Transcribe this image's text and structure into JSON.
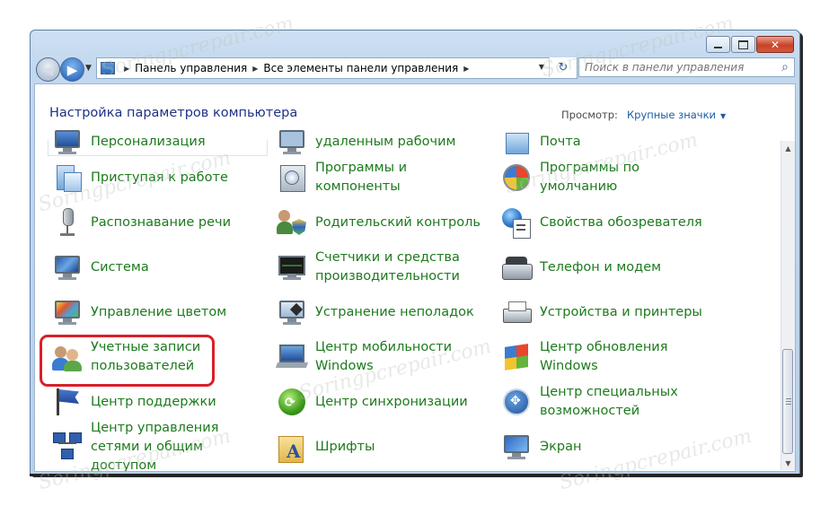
{
  "nav": {
    "address_crumbs": [
      "Панель управления",
      "Все элементы панели управления"
    ],
    "search_placeholder": "Поиск в панели управления"
  },
  "header": {
    "title": "Настройка параметров компьютера",
    "view_label": "Просмотр:",
    "view_value": "Крупные значки"
  },
  "items": [
    {
      "label": "Персонализация",
      "icon": "personalization-icon"
    },
    {
      "label": "удаленным рабочим",
      "icon": "remote-desktop-icon"
    },
    {
      "label": "Почта",
      "icon": "mail-icon"
    },
    {
      "label": "Приступая к работе",
      "icon": "getting-started-icon"
    },
    {
      "label": "Программы и компоненты",
      "icon": "programs-features-icon"
    },
    {
      "label": "Программы по умолчанию",
      "icon": "default-programs-icon"
    },
    {
      "label": "Распознавание речи",
      "icon": "microphone-icon"
    },
    {
      "label": "Родительский контроль",
      "icon": "parental-controls-icon"
    },
    {
      "label": "Свойства обозревателя",
      "icon": "internet-options-icon"
    },
    {
      "label": "Система",
      "icon": "system-icon"
    },
    {
      "label": "Счетчики и средства производительности",
      "icon": "performance-icon"
    },
    {
      "label": "Телефон и модем",
      "icon": "phone-modem-icon"
    },
    {
      "label": "Управление цветом",
      "icon": "color-management-icon"
    },
    {
      "label": "Устранение неполадок",
      "icon": "troubleshooting-icon"
    },
    {
      "label": "Устройства и принтеры",
      "icon": "devices-printers-icon"
    },
    {
      "label": "Учетные записи пользователей",
      "icon": "user-accounts-icon"
    },
    {
      "label": "Центр мобильности Windows",
      "icon": "mobility-center-icon"
    },
    {
      "label": "Центр обновления Windows",
      "icon": "windows-update-icon"
    },
    {
      "label": "Центр поддержки",
      "icon": "action-center-flag-icon"
    },
    {
      "label": "Центр синхронизации",
      "icon": "sync-center-icon"
    },
    {
      "label": "Центр специальных возможностей",
      "icon": "ease-of-access-icon"
    },
    {
      "label": "Центр управления сетями и общим доступом",
      "icon": "network-center-icon"
    },
    {
      "label": "Шрифты",
      "icon": "fonts-folder-icon"
    },
    {
      "label": "Экран",
      "icon": "display-icon"
    }
  ],
  "watermark": "Soringpcrepair.com",
  "colors": {
    "link_green": "#1d7a1d",
    "title_blue": "#1e3287",
    "highlight_red": "#d8202a"
  }
}
